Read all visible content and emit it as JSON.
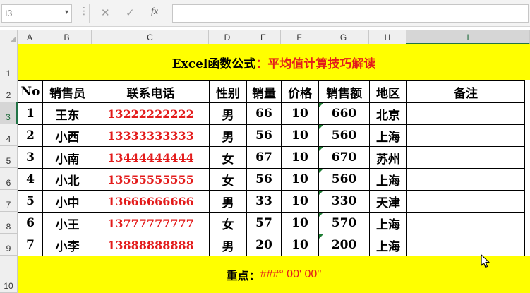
{
  "formula_bar": {
    "name_box": "I3",
    "name_box_arrow": "▾",
    "cancel_icon": "✕",
    "enter_icon": "✓",
    "fx_label": "fx",
    "formula": ""
  },
  "columns": [
    "A",
    "B",
    "C",
    "D",
    "E",
    "F",
    "G",
    "H",
    "I"
  ],
  "rows": [
    "1",
    "2",
    "3",
    "4",
    "5",
    "6",
    "7",
    "8",
    "9",
    "10"
  ],
  "title": {
    "prefix": "Excel函数公式",
    "colon": "：",
    "highlight": "平均值计算技巧解读"
  },
  "table": {
    "headers": [
      "No",
      "销售员",
      "联系电话",
      "性别",
      "销量",
      "价格",
      "销售额",
      "地区",
      "备注"
    ],
    "rows": [
      [
        "1",
        "王东",
        "13222222222",
        "男",
        "66",
        "10",
        "660",
        "北京",
        ""
      ],
      [
        "2",
        "小西",
        "13333333333",
        "男",
        "56",
        "10",
        "560",
        "上海",
        ""
      ],
      [
        "3",
        "小南",
        "13444444444",
        "女",
        "67",
        "10",
        "670",
        "苏州",
        ""
      ],
      [
        "4",
        "小北",
        "13555555555",
        "女",
        "56",
        "10",
        "560",
        "上海",
        ""
      ],
      [
        "5",
        "小中",
        "13666666666",
        "男",
        "33",
        "10",
        "330",
        "天津",
        ""
      ],
      [
        "6",
        "小王",
        "13777777777",
        "女",
        "57",
        "10",
        "570",
        "上海",
        ""
      ],
      [
        "7",
        "小李",
        "13888888888",
        "男",
        "20",
        "10",
        "200",
        "上海",
        ""
      ]
    ]
  },
  "footer": {
    "label": "重点：",
    "value": "###° 00' 00''"
  },
  "colors": {
    "banner_bg": "#ffff00",
    "accent_red": "#e31b1b",
    "excel_green": "#217346"
  }
}
